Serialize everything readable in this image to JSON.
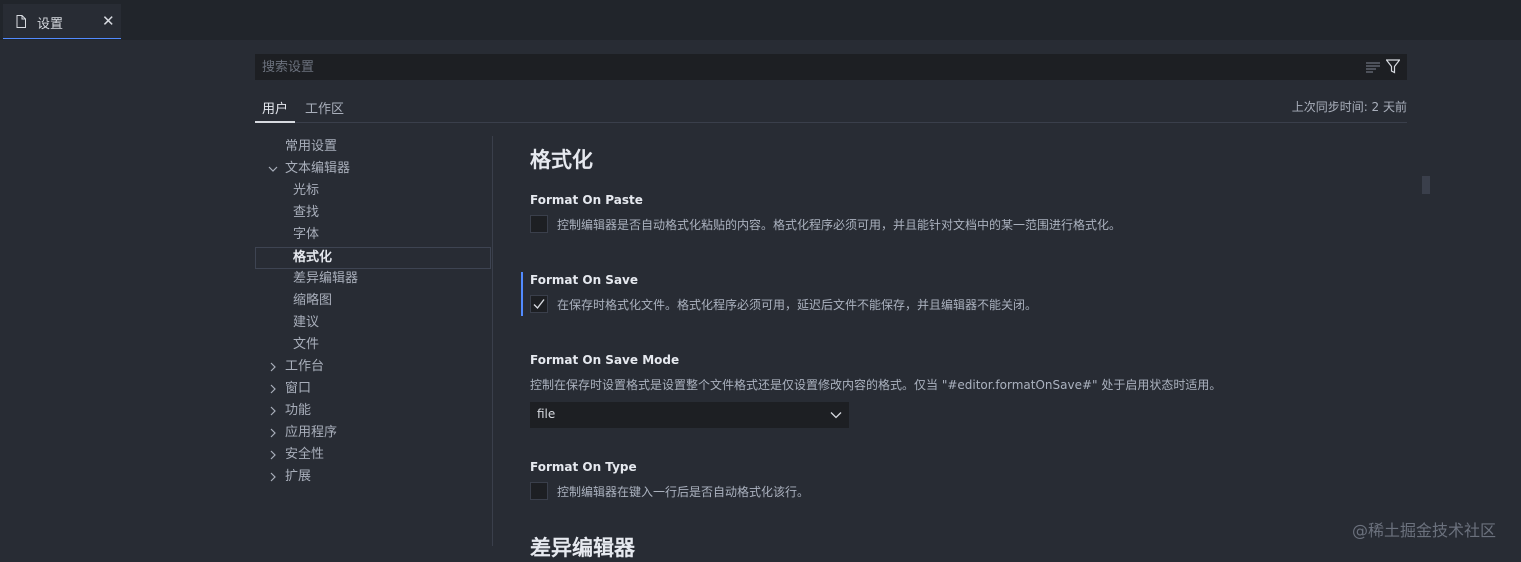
{
  "window": {
    "tab": {
      "icon": "file-icon",
      "label": "设置",
      "close_icon": "close-icon"
    }
  },
  "search": {
    "placeholder": "搜索设置",
    "value": "",
    "clear_icon": "clear-filter-icon",
    "filter_icon": "filter-icon"
  },
  "scope": {
    "tabs": [
      {
        "label": "用户",
        "active": true
      },
      {
        "label": "工作区",
        "active": false
      }
    ],
    "sync_status": "上次同步时间: 2 天前"
  },
  "toc": {
    "items": [
      {
        "label": "常用设置",
        "level": 0,
        "chevron": ""
      },
      {
        "label": "文本编辑器",
        "level": 0,
        "chevron": "expanded"
      },
      {
        "label": "光标",
        "level": 1,
        "chevron": ""
      },
      {
        "label": "查找",
        "level": 1,
        "chevron": ""
      },
      {
        "label": "字体",
        "level": 1,
        "chevron": ""
      },
      {
        "label": "格式化",
        "level": 1,
        "chevron": "",
        "active": true
      },
      {
        "label": "差异编辑器",
        "level": 1,
        "chevron": ""
      },
      {
        "label": "缩略图",
        "level": 1,
        "chevron": ""
      },
      {
        "label": "建议",
        "level": 1,
        "chevron": ""
      },
      {
        "label": "文件",
        "level": 1,
        "chevron": ""
      },
      {
        "label": "工作台",
        "level": 0,
        "chevron": "collapsed"
      },
      {
        "label": "窗口",
        "level": 0,
        "chevron": "collapsed"
      },
      {
        "label": "功能",
        "level": 0,
        "chevron": "collapsed"
      },
      {
        "label": "应用程序",
        "level": 0,
        "chevron": "collapsed"
      },
      {
        "label": "安全性",
        "level": 0,
        "chevron": "collapsed"
      },
      {
        "label": "扩展",
        "level": 0,
        "chevron": "collapsed"
      }
    ]
  },
  "content": {
    "section_title": "格式化",
    "settings": [
      {
        "title": "Format On Paste",
        "description": "控制编辑器是否自动格式化粘贴的内容。格式化程序必须可用，并且能针对文档中的某一范围进行格式化。",
        "checked": false
      },
      {
        "title": "Format On Save",
        "description": "在保存时格式化文件。格式化程序必须可用，延迟后文件不能保存，并且编辑器不能关闭。",
        "checked": true
      },
      {
        "title": "Format On Save Mode",
        "description": "控制在保存时设置格式是设置整个文件格式还是仅设置修改内容的格式。仅当 \"#editor.formatOnSave#\" 处于启用状态时适用。",
        "select_value": "file"
      },
      {
        "title": "Format On Type",
        "description": "控制编辑器在键入一行后是否自动格式化该行。",
        "checked": false
      }
    ],
    "next_section_title": "差异编辑器"
  },
  "watermark": "@稀土掘金技术社区",
  "colors": {
    "background": "#282c34",
    "tabbar": "#21252b",
    "accent": "#528bff",
    "input_bg": "#1d1f23"
  }
}
